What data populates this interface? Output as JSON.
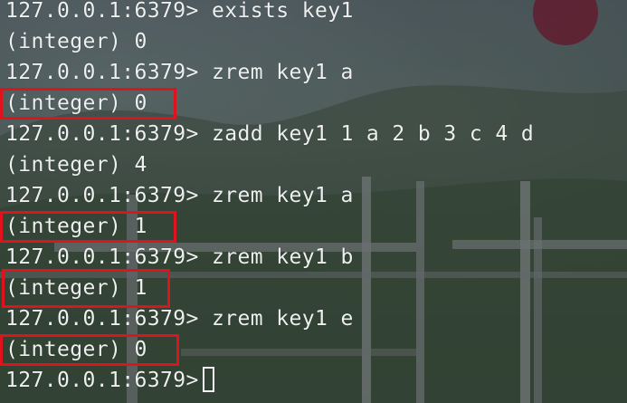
{
  "terminal": {
    "lines": [
      {
        "prompt": "127.0.0.1:6379>",
        "command": "exists key1"
      },
      {
        "output": "(integer) 0"
      },
      {
        "prompt": "127.0.0.1:6379>",
        "command": "zrem key1 a"
      },
      {
        "output": "(integer) 0"
      },
      {
        "prompt": "127.0.0.1:6379>",
        "command": "zadd key1 1 a 2 b 3 c 4 d"
      },
      {
        "output": "(integer) 4"
      },
      {
        "prompt": "127.0.0.1:6379>",
        "command": "zrem key1 a"
      },
      {
        "output": "(integer) 1"
      },
      {
        "prompt": "127.0.0.1:6379>",
        "command": "zrem key1 b"
      },
      {
        "output": "(integer) 1"
      },
      {
        "prompt": "127.0.0.1:6379>",
        "command": "zrem key1 e"
      },
      {
        "output": "(integer) 0"
      },
      {
        "prompt": "127.0.0.1:6379>",
        "command": ""
      }
    ]
  },
  "colors": {
    "text": "#eef0f0",
    "highlight": "#e0131c"
  }
}
